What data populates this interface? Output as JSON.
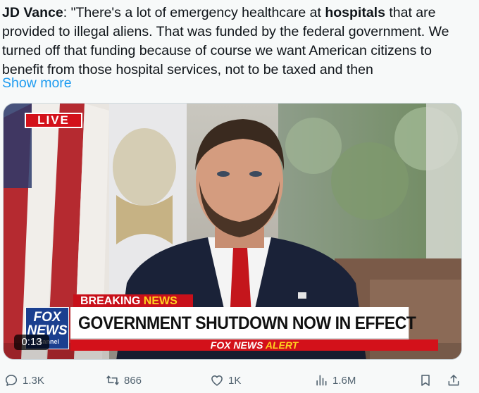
{
  "tweet": {
    "author_mention": "JD Vance",
    "quote_before_bold": ": \"There's a lot of emergency healthcare at ",
    "bold_word": "hospitals",
    "quote_after_bold": " that are provided to illegal aliens. That was funded by the federal government. We turned off that funding because of course we want American citizens to benefit from those hospital services, not to be taxed and then",
    "show_more_label": "Show more"
  },
  "video": {
    "live_label": "LIVE",
    "breaking_word1": "BREAKING",
    "breaking_word2": "NEWS",
    "headline": "GOVERNMENT SHUTDOWN NOW IN EFFECT",
    "alert_brand": "FOX NEWS",
    "alert_word": "ALERT",
    "logo_line1": "FOX",
    "logo_line2": "NEWS",
    "logo_line3": "channel",
    "timestamp": "0:13"
  },
  "actions": {
    "replies": "1.3K",
    "reposts": "866",
    "likes": "1K",
    "views": "1.6M"
  },
  "colors": {
    "link_blue": "#1d9bf0",
    "muted_gray": "#536471",
    "fox_red": "#d3111a",
    "fox_blue": "#1b3f8f",
    "alert_yellow": "#ffd21f"
  }
}
